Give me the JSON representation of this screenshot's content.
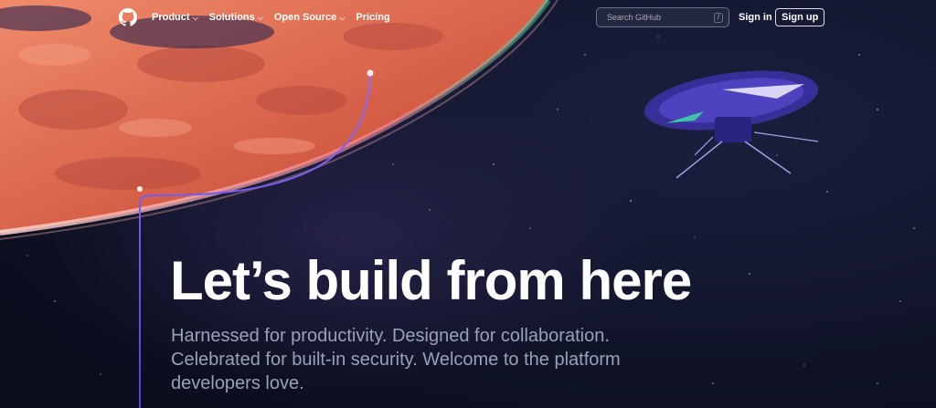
{
  "header": {
    "logo_icon": "github-mark-icon",
    "nav": [
      {
        "label": "Product",
        "has_dropdown": true
      },
      {
        "label": "Solutions",
        "has_dropdown": true
      },
      {
        "label": "Open Source",
        "has_dropdown": true
      },
      {
        "label": "Pricing",
        "has_dropdown": false
      }
    ],
    "search": {
      "placeholder": "Search GitHub",
      "shortcut": "/"
    },
    "signin_label": "Sign in",
    "signup_label": "Sign up"
  },
  "hero": {
    "title": "Let’s build from here",
    "subtitle": "Harnessed for productivity. Designed for collaboration. Celebrated for built-in security. Welcome to the platform developers love."
  },
  "colors": {
    "background": "#0d1021",
    "planet": "#e0694e",
    "accent_line": "#7c5cff",
    "subtitle_text": "#9aa0b8"
  }
}
